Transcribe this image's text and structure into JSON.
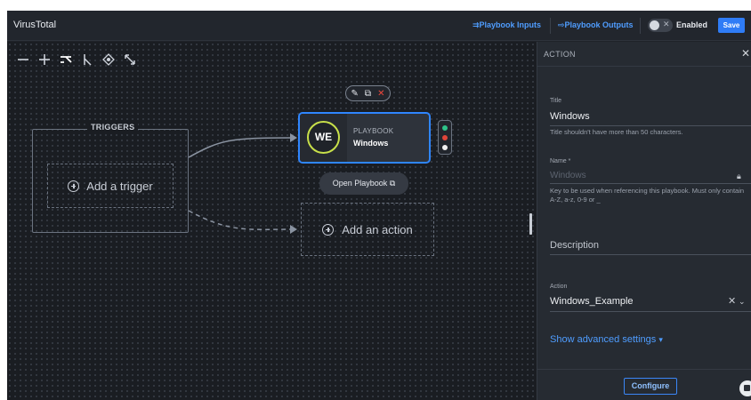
{
  "app": {
    "title": "VirusTotal"
  },
  "topbar": {
    "playbook_inputs": "Playbook Inputs",
    "playbook_outputs": "Playbook Outputs",
    "toggle_state": "Enabled",
    "save_label": "Save"
  },
  "toolbar": {
    "tools": [
      "zoom-out-icon",
      "zoom-in-icon",
      "branch-icon",
      "pointer-icon",
      "target-icon",
      "expand-icon"
    ]
  },
  "canvas": {
    "triggers_label": "TRIGGERS",
    "add_trigger": "Add a trigger",
    "node": {
      "initials": "WE",
      "kind": "PLAYBOOK",
      "name": "Windows",
      "ring_color": "#c8e04a",
      "border_color": "#2f86ff"
    },
    "node_actions": [
      "edit-icon",
      "copy-icon",
      "delete-icon"
    ],
    "status_lights": [
      "#2ec48a",
      "#e0453a",
      "#f2f2f2"
    ],
    "open_playbook": "Open Playbook",
    "add_action": "Add an action"
  },
  "panel": {
    "header": "ACTION",
    "title_label": "Title",
    "title_value": "Windows",
    "title_hint": "Title shouldn't have more than 50 characters.",
    "name_label": "Name *",
    "name_placeholder": "Windows",
    "name_hint": "Key to be used when referencing this playbook. Must only contain A-Z, a-z, 0-9 or _",
    "description_label": "Description",
    "action_label": "Action",
    "action_value": "Windows_Example",
    "advanced_link": "Show advanced settings",
    "configure_label": "Configure"
  },
  "colors": {
    "accent": "#2f7cf6",
    "link": "#4f9dff",
    "canvas_bg": "#1a1d22",
    "panel_bg": "#262b32"
  }
}
